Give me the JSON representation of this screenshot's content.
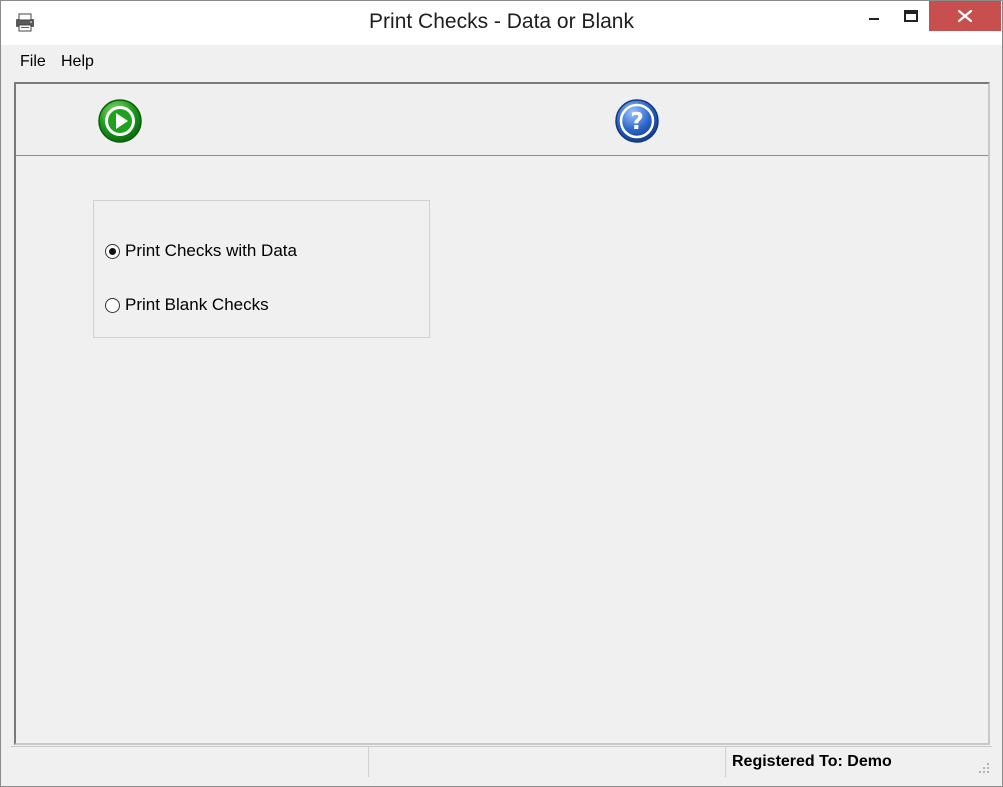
{
  "window": {
    "title": "Print Checks - Data or Blank",
    "app_icon": "printer-icon",
    "controls": [
      "minimize-icon",
      "maximize-icon",
      "close-icon"
    ]
  },
  "menu": {
    "items": [
      {
        "label": "File"
      },
      {
        "label": "Help"
      }
    ]
  },
  "toolbar": {
    "buttons": [
      {
        "icon": "play-icon",
        "color": "#1c9a1c"
      },
      {
        "icon": "help-icon",
        "color": "#2a63c8"
      }
    ]
  },
  "options": {
    "selected": 0,
    "items": [
      {
        "label": "Print Checks with Data",
        "checked": true
      },
      {
        "label": "Print Blank Checks",
        "checked": false
      }
    ]
  },
  "statusbar": {
    "panels": [
      "",
      "",
      "Registered To: Demo"
    ]
  },
  "colors": {
    "background": "#f0f0f0",
    "close_button": "#c7504f"
  }
}
